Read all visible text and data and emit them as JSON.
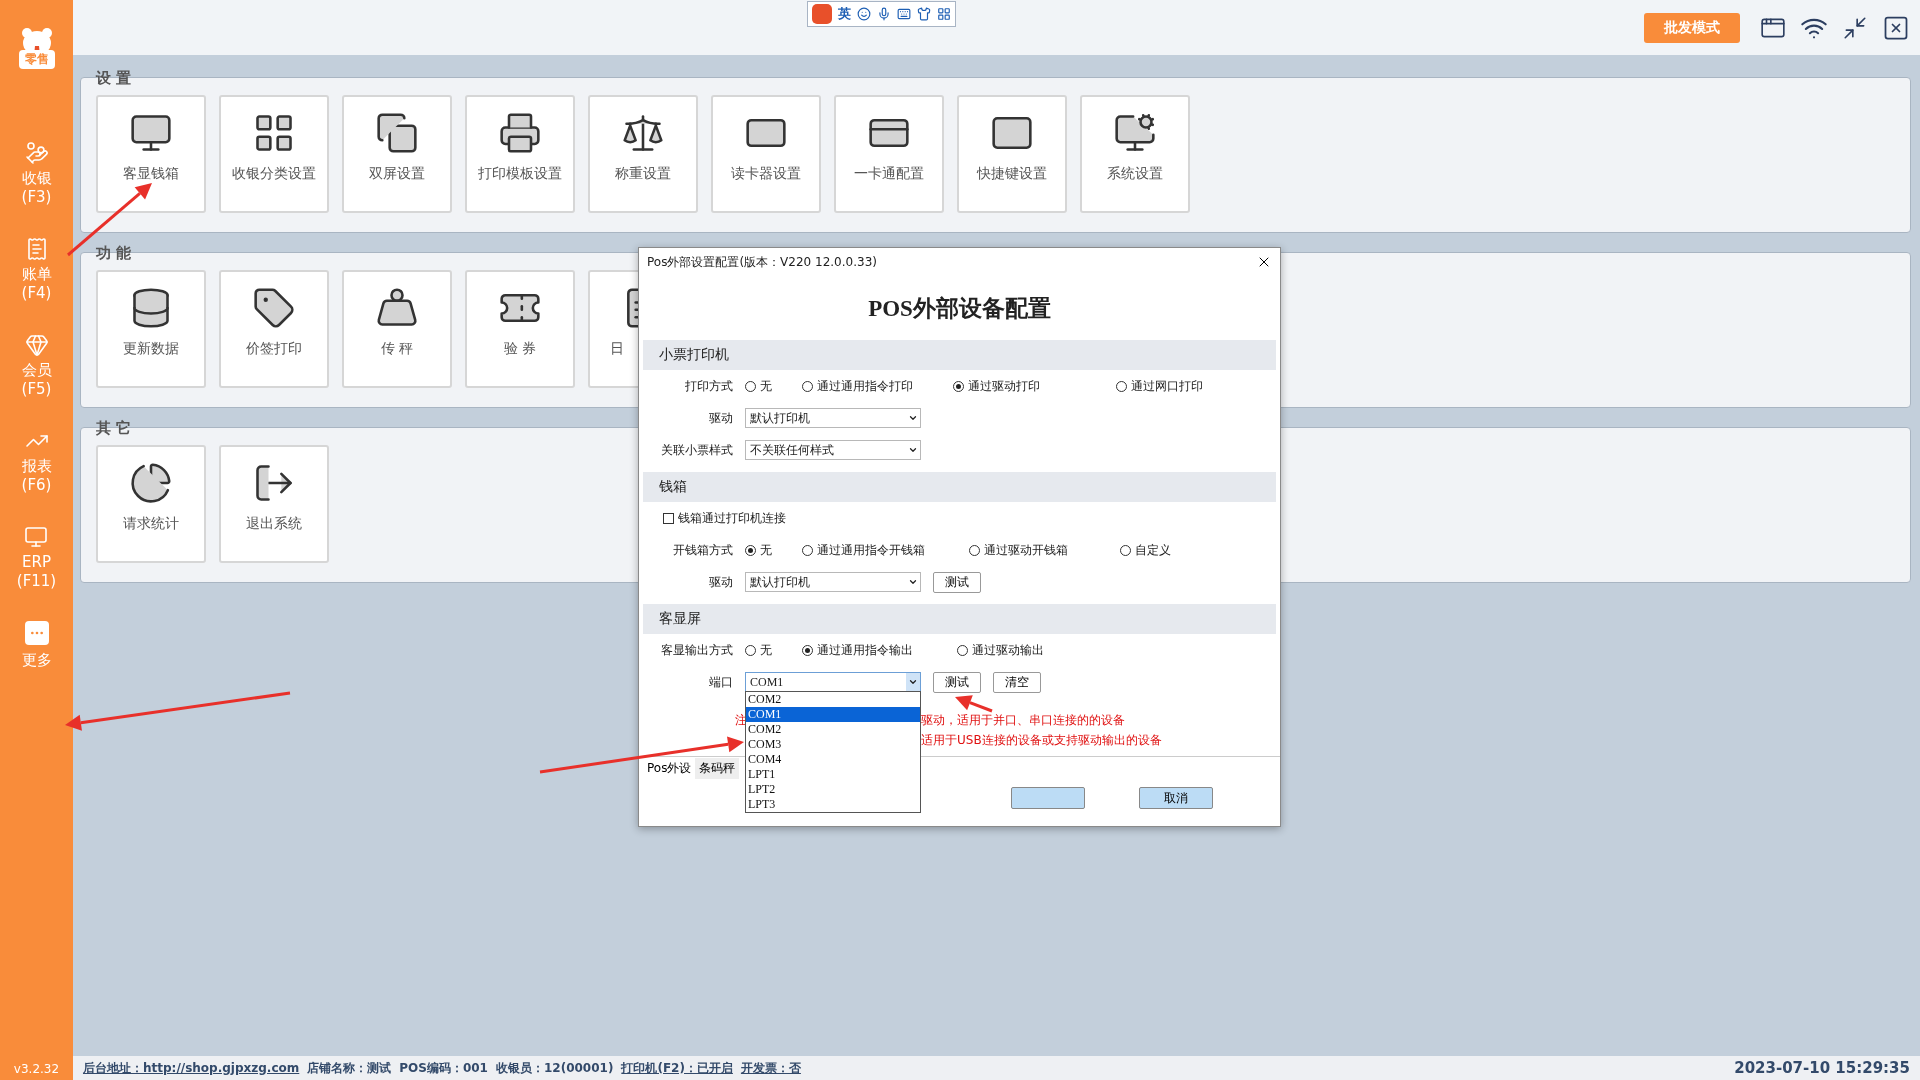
{
  "sidebar": {
    "logo_text": "零售",
    "items": [
      {
        "label": "收银",
        "shortcut": "(F3)"
      },
      {
        "label": "账单",
        "shortcut": "(F4)"
      },
      {
        "label": "会员",
        "shortcut": "(F5)"
      },
      {
        "label": "报表",
        "shortcut": "(F6)"
      },
      {
        "label": "ERP",
        "shortcut": "(F11)"
      },
      {
        "label": "更多"
      }
    ],
    "version": "v3.2.32"
  },
  "top_bar": {
    "ime_language": "英",
    "mode_button": "批发模式"
  },
  "sections": [
    {
      "title": "设 置",
      "tiles": [
        {
          "label": "客显钱箱"
        },
        {
          "label": "收银分类设置"
        },
        {
          "label": "双屏设置"
        },
        {
          "label": "打印模板设置"
        },
        {
          "label": "称重设置"
        },
        {
          "label": "读卡器设置"
        },
        {
          "label": "一卡通配置"
        },
        {
          "label": "快捷键设置"
        },
        {
          "label": "系统设置"
        }
      ]
    },
    {
      "title": "功 能",
      "tiles": [
        {
          "label": "更新数据"
        },
        {
          "label": "价签打印"
        },
        {
          "label": "传 秤"
        },
        {
          "label": "验 券"
        },
        {
          "label": "日"
        }
      ]
    },
    {
      "title": "其 它",
      "tiles": [
        {
          "label": "请求统计"
        },
        {
          "label": "退出系统"
        }
      ]
    }
  ],
  "dialog": {
    "title": "Pos外部设置配置(版本：V220  12.0.0.33)",
    "heading": "POS外部设备配置",
    "groups": [
      {
        "title": "小票打印机",
        "rows": [
          {
            "kind": "radio",
            "label": "打印方式",
            "options": [
              {
                "label": "无",
                "selected": false
              },
              {
                "label": "通过通用指令打印",
                "selected": false
              },
              {
                "label": "通过驱动打印",
                "selected": true
              },
              {
                "label": "通过网口打印",
                "selected": false
              }
            ]
          },
          {
            "kind": "select",
            "label": "驱动",
            "value": "默认打印机"
          },
          {
            "kind": "select",
            "label": "关联小票样式",
            "value": "不关联任何样式"
          }
        ]
      },
      {
        "title": "钱箱",
        "rows": [
          {
            "kind": "checkbox",
            "label": "钱箱通过打印机连接",
            "checked": false
          },
          {
            "kind": "radio",
            "label": "开钱箱方式",
            "options": [
              {
                "label": "无",
                "selected": true
              },
              {
                "label": "通过通用指令开钱箱",
                "selected": false
              },
              {
                "label": "通过驱动开钱箱",
                "selected": false
              },
              {
                "label": "自定义",
                "selected": false
              }
            ]
          },
          {
            "kind": "select",
            "label": "驱动",
            "value": "默认打印机",
            "buttons": [
              "测试"
            ]
          }
        ]
      },
      {
        "title": "客显屏",
        "rows": [
          {
            "kind": "radio",
            "label": "客显输出方式",
            "options": [
              {
                "label": "无",
                "selected": false
              },
              {
                "label": "通过通用指令输出",
                "selected": true
              },
              {
                "label": "通过驱动输出",
                "selected": false
              }
            ]
          },
          {
            "kind": "select",
            "label": "端口",
            "value": "COM1",
            "open": true,
            "buttons": [
              "测试",
              "清空"
            ],
            "options": [
              {
                "label": "COM2",
                "selected": false
              },
              {
                "label": "COM1",
                "selected": true
              },
              {
                "label": "COM2",
                "selected": false
              },
              {
                "label": "COM3",
                "selected": false
              },
              {
                "label": "COM4",
                "selected": false
              },
              {
                "label": "LPT1",
                "selected": false
              },
              {
                "label": "LPT2",
                "selected": false
              },
              {
                "label": "LPT3",
                "selected": false
              }
            ]
          }
        ]
      }
    ],
    "notes": [
      "注",
      "驱动，适用于并口、串口连接的的设备",
      "适用于USB连接的设备或支持驱动输出的设备"
    ],
    "tabs": [
      {
        "label": "Pos外设",
        "selected": true
      },
      {
        "label": "条码秤",
        "selected": false
      }
    ],
    "buttons": [
      "取消"
    ]
  },
  "status_bar": {
    "items": [
      {
        "text": "后台地址：http://shop.gjpxzg.com",
        "kind": "link"
      },
      {
        "text": "店铺名称：测试",
        "kind": "plain"
      },
      {
        "text": "POS编码：001",
        "kind": "plain"
      },
      {
        "text": "收银员：12(00001)",
        "kind": "plain"
      },
      {
        "text": "打印机(F2)：已开启",
        "kind": "link"
      },
      {
        "text": "开发票：否",
        "kind": "link"
      }
    ],
    "datetime": "2023-07-10 15:29:35"
  }
}
